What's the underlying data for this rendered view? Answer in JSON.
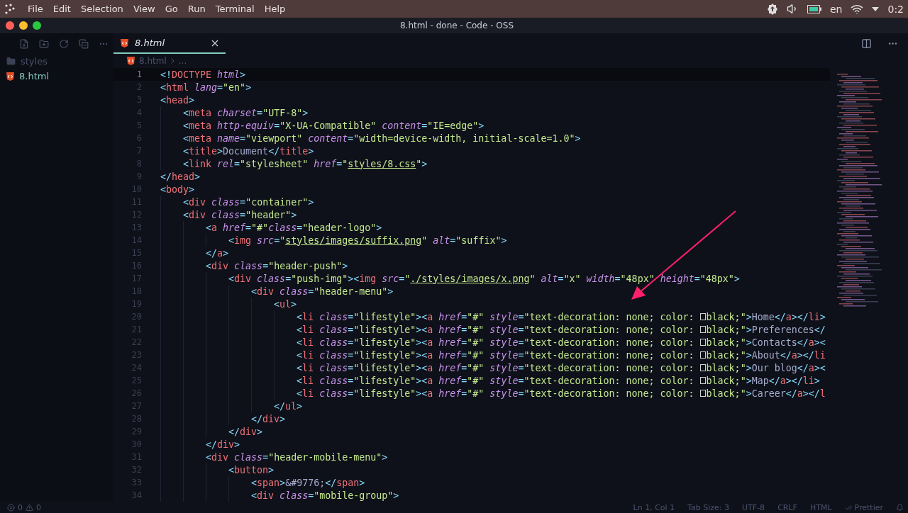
{
  "menu": [
    "File",
    "Edit",
    "Selection",
    "View",
    "Go",
    "Run",
    "Terminal",
    "Help"
  ],
  "tray": {
    "language": "en",
    "clock": "0:2"
  },
  "window": {
    "title": "8.html - done - Code - OSS"
  },
  "explorer": {
    "items": [
      {
        "kind": "folder",
        "label": "styles",
        "selected": false
      },
      {
        "kind": "file",
        "label": "8.html",
        "selected": true
      }
    ]
  },
  "tabs": [
    {
      "label": "8.html",
      "selected": true
    }
  ],
  "breadcrumb": [
    "8.html",
    "..."
  ],
  "lines": [
    {
      "n": "1",
      "current": true,
      "tokens": [
        {
          "kind": "punct",
          "t": "<!"
        },
        {
          "kind": "tag",
          "t": "DOCTYPE"
        },
        {
          "kind": "attr",
          "t": " html"
        },
        {
          "kind": "punct",
          "t": ">"
        }
      ]
    },
    {
      "n": "2",
      "current": false,
      "tokens": [
        {
          "kind": "punct",
          "t": "<"
        },
        {
          "kind": "tag",
          "t": "html"
        },
        {
          "kind": "attr",
          "t": " lang"
        },
        {
          "kind": "punct",
          "t": "="
        },
        {
          "kind": "string",
          "t": "\"en\""
        },
        {
          "kind": "punct",
          "t": ">"
        }
      ]
    },
    {
      "n": "3",
      "current": false,
      "tokens": [
        {
          "kind": "punct",
          "t": "<"
        },
        {
          "kind": "tag",
          "t": "head"
        },
        {
          "kind": "punct",
          "t": ">"
        }
      ]
    },
    {
      "n": "4",
      "current": false,
      "tokens": [
        {
          "kind": "punct",
          "t": "    <"
        },
        {
          "kind": "tag",
          "t": "meta"
        },
        {
          "kind": "attr",
          "t": " charset"
        },
        {
          "kind": "punct",
          "t": "="
        },
        {
          "kind": "string",
          "t": "\"UTF-8\""
        },
        {
          "kind": "punct",
          "t": ">"
        }
      ]
    },
    {
      "n": "5",
      "current": false,
      "tokens": [
        {
          "kind": "punct",
          "t": "    <"
        },
        {
          "kind": "tag",
          "t": "meta"
        },
        {
          "kind": "attr",
          "t": " http-equiv"
        },
        {
          "kind": "punct",
          "t": "="
        },
        {
          "kind": "string",
          "t": "\"X-UA-Compatible\""
        },
        {
          "kind": "attr",
          "t": " content"
        },
        {
          "kind": "punct",
          "t": "="
        },
        {
          "kind": "string",
          "t": "\"IE=edge\""
        },
        {
          "kind": "punct",
          "t": ">"
        }
      ]
    },
    {
      "n": "6",
      "current": false,
      "tokens": [
        {
          "kind": "punct",
          "t": "    <"
        },
        {
          "kind": "tag",
          "t": "meta"
        },
        {
          "kind": "attr",
          "t": " name"
        },
        {
          "kind": "punct",
          "t": "="
        },
        {
          "kind": "string",
          "t": "\"viewport\""
        },
        {
          "kind": "attr",
          "t": " content"
        },
        {
          "kind": "punct",
          "t": "="
        },
        {
          "kind": "string",
          "t": "\"width=device-width, initial-scale=1.0\""
        },
        {
          "kind": "punct",
          "t": ">"
        }
      ]
    },
    {
      "n": "7",
      "current": false,
      "tokens": [
        {
          "kind": "punct",
          "t": "    <"
        },
        {
          "kind": "tag",
          "t": "title"
        },
        {
          "kind": "punct",
          "t": ">"
        },
        {
          "kind": "text",
          "t": "Document"
        },
        {
          "kind": "punct",
          "t": "</"
        },
        {
          "kind": "tag",
          "t": "title"
        },
        {
          "kind": "punct",
          "t": ">"
        }
      ]
    },
    {
      "n": "8",
      "current": false,
      "tokens": [
        {
          "kind": "punct",
          "t": "    <"
        },
        {
          "kind": "tag",
          "t": "link"
        },
        {
          "kind": "attr",
          "t": " rel"
        },
        {
          "kind": "punct",
          "t": "="
        },
        {
          "kind": "string",
          "t": "\"stylesheet\""
        },
        {
          "kind": "attr",
          "t": " href"
        },
        {
          "kind": "punct",
          "t": "="
        },
        {
          "kind": "string",
          "t": "\""
        },
        {
          "kind": "link",
          "t": "styles/8.css"
        },
        {
          "kind": "string",
          "t": "\""
        },
        {
          "kind": "punct",
          "t": ">"
        }
      ]
    },
    {
      "n": "9",
      "current": false,
      "tokens": [
        {
          "kind": "punct",
          "t": "</"
        },
        {
          "kind": "tag",
          "t": "head"
        },
        {
          "kind": "punct",
          "t": ">"
        }
      ]
    },
    {
      "n": "10",
      "current": false,
      "tokens": [
        {
          "kind": "punct",
          "t": "<"
        },
        {
          "kind": "tag",
          "t": "body"
        },
        {
          "kind": "punct",
          "t": ">"
        }
      ]
    },
    {
      "n": "11",
      "current": false,
      "tokens": [
        {
          "kind": "punct",
          "t": "    <"
        },
        {
          "kind": "tag",
          "t": "div"
        },
        {
          "kind": "attr",
          "t": " class"
        },
        {
          "kind": "punct",
          "t": "="
        },
        {
          "kind": "string",
          "t": "\"container\""
        },
        {
          "kind": "punct",
          "t": ">"
        }
      ]
    },
    {
      "n": "12",
      "current": false,
      "tokens": [
        {
          "kind": "punct",
          "t": "    <"
        },
        {
          "kind": "tag",
          "t": "div"
        },
        {
          "kind": "attr",
          "t": " class"
        },
        {
          "kind": "punct",
          "t": "="
        },
        {
          "kind": "string",
          "t": "\"header\""
        },
        {
          "kind": "punct",
          "t": ">"
        }
      ]
    },
    {
      "n": "13",
      "current": false,
      "tokens": [
        {
          "kind": "punct",
          "t": "        <"
        },
        {
          "kind": "tag",
          "t": "a"
        },
        {
          "kind": "attr",
          "t": " href"
        },
        {
          "kind": "punct",
          "t": "="
        },
        {
          "kind": "string",
          "t": "\"#\""
        },
        {
          "kind": "attr",
          "t": "class"
        },
        {
          "kind": "punct",
          "t": "="
        },
        {
          "kind": "string",
          "t": "\"header-logo\""
        },
        {
          "kind": "punct",
          "t": ">"
        }
      ]
    },
    {
      "n": "14",
      "current": false,
      "tokens": [
        {
          "kind": "punct",
          "t": "            <"
        },
        {
          "kind": "tag",
          "t": "img"
        },
        {
          "kind": "attr",
          "t": " src"
        },
        {
          "kind": "punct",
          "t": "="
        },
        {
          "kind": "string",
          "t": "\""
        },
        {
          "kind": "link",
          "t": "styles/images/suffix.png"
        },
        {
          "kind": "string",
          "t": "\""
        },
        {
          "kind": "attr",
          "t": " alt"
        },
        {
          "kind": "punct",
          "t": "="
        },
        {
          "kind": "string",
          "t": "\"suffix\""
        },
        {
          "kind": "punct",
          "t": ">"
        }
      ]
    },
    {
      "n": "15",
      "current": false,
      "tokens": [
        {
          "kind": "punct",
          "t": "        </"
        },
        {
          "kind": "tag",
          "t": "a"
        },
        {
          "kind": "punct",
          "t": ">"
        }
      ]
    },
    {
      "n": "16",
      "current": false,
      "tokens": [
        {
          "kind": "punct",
          "t": "        <"
        },
        {
          "kind": "tag",
          "t": "div"
        },
        {
          "kind": "attr",
          "t": " class"
        },
        {
          "kind": "punct",
          "t": "="
        },
        {
          "kind": "string",
          "t": "\"header-push\""
        },
        {
          "kind": "punct",
          "t": ">"
        }
      ]
    },
    {
      "n": "17",
      "current": false,
      "tokens": [
        {
          "kind": "punct",
          "t": "            <"
        },
        {
          "kind": "tag",
          "t": "div"
        },
        {
          "kind": "attr",
          "t": " class"
        },
        {
          "kind": "punct",
          "t": "="
        },
        {
          "kind": "string",
          "t": "\"push-img\""
        },
        {
          "kind": "punct",
          "t": "><"
        },
        {
          "kind": "tag",
          "t": "img"
        },
        {
          "kind": "attr",
          "t": " src"
        },
        {
          "kind": "punct",
          "t": "="
        },
        {
          "kind": "string",
          "t": "\""
        },
        {
          "kind": "link",
          "t": "./styles/images/x.png"
        },
        {
          "kind": "string",
          "t": "\""
        },
        {
          "kind": "attr",
          "t": " alt"
        },
        {
          "kind": "punct",
          "t": "="
        },
        {
          "kind": "string",
          "t": "\"x\""
        },
        {
          "kind": "attr",
          "t": " width"
        },
        {
          "kind": "punct",
          "t": "="
        },
        {
          "kind": "string",
          "t": "\"48px\""
        },
        {
          "kind": "attr",
          "t": " height"
        },
        {
          "kind": "punct",
          "t": "="
        },
        {
          "kind": "string",
          "t": "\"48px\""
        },
        {
          "kind": "punct",
          "t": ">"
        }
      ]
    },
    {
      "n": "18",
      "current": false,
      "tokens": [
        {
          "kind": "punct",
          "t": "                <"
        },
        {
          "kind": "tag",
          "t": "div"
        },
        {
          "kind": "attr",
          "t": " class"
        },
        {
          "kind": "punct",
          "t": "="
        },
        {
          "kind": "string",
          "t": "\"header-menu\""
        },
        {
          "kind": "punct",
          "t": ">"
        }
      ]
    },
    {
      "n": "19",
      "current": false,
      "tokens": [
        {
          "kind": "punct",
          "t": "                    <"
        },
        {
          "kind": "tag",
          "t": "ul"
        },
        {
          "kind": "punct",
          "t": ">"
        }
      ]
    },
    {
      "n": "20",
      "current": false,
      "tokens": [
        {
          "kind": "punct",
          "t": "                        <"
        },
        {
          "kind": "tag",
          "t": "li"
        },
        {
          "kind": "attr",
          "t": " class"
        },
        {
          "kind": "punct",
          "t": "="
        },
        {
          "kind": "string",
          "t": "\"lifestyle\""
        },
        {
          "kind": "punct",
          "t": "><"
        },
        {
          "kind": "tag",
          "t": "a"
        },
        {
          "kind": "attr",
          "t": " href"
        },
        {
          "kind": "punct",
          "t": "="
        },
        {
          "kind": "string",
          "t": "\"#\""
        },
        {
          "kind": "attr",
          "t": " style"
        },
        {
          "kind": "punct",
          "t": "="
        },
        {
          "kind": "string",
          "t": "\"text-decoration: none; color: "
        },
        {
          "kind": "swatch"
        },
        {
          "kind": "string",
          "t": "black;\""
        },
        {
          "kind": "punct",
          "t": ">"
        },
        {
          "kind": "text",
          "t": "Home"
        },
        {
          "kind": "punct",
          "t": "</"
        },
        {
          "kind": "tag",
          "t": "a"
        },
        {
          "kind": "punct",
          "t": "></"
        },
        {
          "kind": "tag",
          "t": "li"
        },
        {
          "kind": "punct",
          "t": ">"
        }
      ]
    },
    {
      "n": "21",
      "current": false,
      "tokens": [
        {
          "kind": "punct",
          "t": "                        <"
        },
        {
          "kind": "tag",
          "t": "li"
        },
        {
          "kind": "attr",
          "t": " class"
        },
        {
          "kind": "punct",
          "t": "="
        },
        {
          "kind": "string",
          "t": "\"lifestyle\""
        },
        {
          "kind": "punct",
          "t": "><"
        },
        {
          "kind": "tag",
          "t": "a"
        },
        {
          "kind": "attr",
          "t": " href"
        },
        {
          "kind": "punct",
          "t": "="
        },
        {
          "kind": "string",
          "t": "\"#\""
        },
        {
          "kind": "attr",
          "t": " style"
        },
        {
          "kind": "punct",
          "t": "="
        },
        {
          "kind": "string",
          "t": "\"text-decoration: none; color: "
        },
        {
          "kind": "swatch"
        },
        {
          "kind": "string",
          "t": "black;\""
        },
        {
          "kind": "punct",
          "t": ">"
        },
        {
          "kind": "text",
          "t": "Preferences"
        },
        {
          "kind": "punct",
          "t": "</"
        }
      ]
    },
    {
      "n": "22",
      "current": false,
      "tokens": [
        {
          "kind": "punct",
          "t": "                        <"
        },
        {
          "kind": "tag",
          "t": "li"
        },
        {
          "kind": "attr",
          "t": " class"
        },
        {
          "kind": "punct",
          "t": "="
        },
        {
          "kind": "string",
          "t": "\"lifestyle\""
        },
        {
          "kind": "punct",
          "t": "><"
        },
        {
          "kind": "tag",
          "t": "a"
        },
        {
          "kind": "attr",
          "t": " href"
        },
        {
          "kind": "punct",
          "t": "="
        },
        {
          "kind": "string",
          "t": "\"#\""
        },
        {
          "kind": "attr",
          "t": " style"
        },
        {
          "kind": "punct",
          "t": "="
        },
        {
          "kind": "string",
          "t": "\"text-decoration: none; color: "
        },
        {
          "kind": "swatch"
        },
        {
          "kind": "string",
          "t": "black;\""
        },
        {
          "kind": "punct",
          "t": ">"
        },
        {
          "kind": "text",
          "t": "Contacts"
        },
        {
          "kind": "punct",
          "t": "</"
        },
        {
          "kind": "tag",
          "t": "a"
        },
        {
          "kind": "punct",
          "t": "><"
        }
      ]
    },
    {
      "n": "23",
      "current": false,
      "tokens": [
        {
          "kind": "punct",
          "t": "                        <"
        },
        {
          "kind": "tag",
          "t": "li"
        },
        {
          "kind": "attr",
          "t": " class"
        },
        {
          "kind": "punct",
          "t": "="
        },
        {
          "kind": "string",
          "t": "\"lifestyle\""
        },
        {
          "kind": "punct",
          "t": "><"
        },
        {
          "kind": "tag",
          "t": "a"
        },
        {
          "kind": "attr",
          "t": " href"
        },
        {
          "kind": "punct",
          "t": "="
        },
        {
          "kind": "string",
          "t": "\"#\""
        },
        {
          "kind": "attr",
          "t": " style"
        },
        {
          "kind": "punct",
          "t": "="
        },
        {
          "kind": "string",
          "t": "\"text-decoration: none; color: "
        },
        {
          "kind": "swatch"
        },
        {
          "kind": "string",
          "t": "black;\""
        },
        {
          "kind": "punct",
          "t": ">"
        },
        {
          "kind": "text",
          "t": "About"
        },
        {
          "kind": "punct",
          "t": "</"
        },
        {
          "kind": "tag",
          "t": "a"
        },
        {
          "kind": "punct",
          "t": "></"
        },
        {
          "kind": "tag",
          "t": "li"
        }
      ]
    },
    {
      "n": "24",
      "current": false,
      "tokens": [
        {
          "kind": "punct",
          "t": "                        <"
        },
        {
          "kind": "tag",
          "t": "li"
        },
        {
          "kind": "attr",
          "t": " class"
        },
        {
          "kind": "punct",
          "t": "="
        },
        {
          "kind": "string",
          "t": "\"lifestyle\""
        },
        {
          "kind": "punct",
          "t": "><"
        },
        {
          "kind": "tag",
          "t": "a"
        },
        {
          "kind": "attr",
          "t": " href"
        },
        {
          "kind": "punct",
          "t": "="
        },
        {
          "kind": "string",
          "t": "\"#\""
        },
        {
          "kind": "attr",
          "t": " style"
        },
        {
          "kind": "punct",
          "t": "="
        },
        {
          "kind": "string",
          "t": "\"text-decoration: none; color: "
        },
        {
          "kind": "swatch"
        },
        {
          "kind": "string",
          "t": "black;\""
        },
        {
          "kind": "punct",
          "t": ">"
        },
        {
          "kind": "text",
          "t": "Our blog"
        },
        {
          "kind": "punct",
          "t": "</"
        },
        {
          "kind": "tag",
          "t": "a"
        },
        {
          "kind": "punct",
          "t": "><"
        }
      ]
    },
    {
      "n": "25",
      "current": false,
      "tokens": [
        {
          "kind": "punct",
          "t": "                        <"
        },
        {
          "kind": "tag",
          "t": "li"
        },
        {
          "kind": "attr",
          "t": " class"
        },
        {
          "kind": "punct",
          "t": "="
        },
        {
          "kind": "string",
          "t": "\"lifestyle\""
        },
        {
          "kind": "punct",
          "t": "><"
        },
        {
          "kind": "tag",
          "t": "a"
        },
        {
          "kind": "attr",
          "t": " href"
        },
        {
          "kind": "punct",
          "t": "="
        },
        {
          "kind": "string",
          "t": "\"#\""
        },
        {
          "kind": "attr",
          "t": " style"
        },
        {
          "kind": "punct",
          "t": "="
        },
        {
          "kind": "string",
          "t": "\"text-decoration: none; color: "
        },
        {
          "kind": "swatch"
        },
        {
          "kind": "string",
          "t": "black;\""
        },
        {
          "kind": "punct",
          "t": ">"
        },
        {
          "kind": "text",
          "t": "Map"
        },
        {
          "kind": "punct",
          "t": "</"
        },
        {
          "kind": "tag",
          "t": "a"
        },
        {
          "kind": "punct",
          "t": "></"
        },
        {
          "kind": "tag",
          "t": "li"
        },
        {
          "kind": "punct",
          "t": ">"
        }
      ]
    },
    {
      "n": "26",
      "current": false,
      "tokens": [
        {
          "kind": "punct",
          "t": "                        <"
        },
        {
          "kind": "tag",
          "t": "li"
        },
        {
          "kind": "attr",
          "t": " class"
        },
        {
          "kind": "punct",
          "t": "="
        },
        {
          "kind": "string",
          "t": "\"lifestyle\""
        },
        {
          "kind": "punct",
          "t": "><"
        },
        {
          "kind": "tag",
          "t": "a"
        },
        {
          "kind": "attr",
          "t": " href"
        },
        {
          "kind": "punct",
          "t": "="
        },
        {
          "kind": "string",
          "t": "\"#\""
        },
        {
          "kind": "attr",
          "t": " style"
        },
        {
          "kind": "punct",
          "t": "="
        },
        {
          "kind": "string",
          "t": "\"text-decoration: none; color: "
        },
        {
          "kind": "swatch"
        },
        {
          "kind": "string",
          "t": "black;\""
        },
        {
          "kind": "punct",
          "t": ">"
        },
        {
          "kind": "text",
          "t": "Career"
        },
        {
          "kind": "punct",
          "t": "</"
        },
        {
          "kind": "tag",
          "t": "a"
        },
        {
          "kind": "punct",
          "t": "></"
        },
        {
          "kind": "tag",
          "t": "l"
        }
      ]
    },
    {
      "n": "27",
      "current": false,
      "tokens": [
        {
          "kind": "punct",
          "t": "                    </"
        },
        {
          "kind": "tag",
          "t": "ul"
        },
        {
          "kind": "punct",
          "t": ">"
        }
      ]
    },
    {
      "n": "28",
      "current": false,
      "tokens": [
        {
          "kind": "punct",
          "t": "                </"
        },
        {
          "kind": "tag",
          "t": "div"
        },
        {
          "kind": "punct",
          "t": ">"
        }
      ]
    },
    {
      "n": "29",
      "current": false,
      "tokens": [
        {
          "kind": "punct",
          "t": "            </"
        },
        {
          "kind": "tag",
          "t": "div"
        },
        {
          "kind": "punct",
          "t": ">"
        }
      ]
    },
    {
      "n": "30",
      "current": false,
      "tokens": [
        {
          "kind": "punct",
          "t": "        </"
        },
        {
          "kind": "tag",
          "t": "div"
        },
        {
          "kind": "punct",
          "t": ">"
        }
      ]
    },
    {
      "n": "31",
      "current": false,
      "tokens": [
        {
          "kind": "punct",
          "t": "        <"
        },
        {
          "kind": "tag",
          "t": "div"
        },
        {
          "kind": "attr",
          "t": " class"
        },
        {
          "kind": "punct",
          "t": "="
        },
        {
          "kind": "string",
          "t": "\"header-mobile-menu\""
        },
        {
          "kind": "punct",
          "t": ">"
        }
      ]
    },
    {
      "n": "32",
      "current": false,
      "tokens": [
        {
          "kind": "punct",
          "t": "            <"
        },
        {
          "kind": "tag",
          "t": "button"
        },
        {
          "kind": "punct",
          "t": ">"
        }
      ]
    },
    {
      "n": "33",
      "current": false,
      "tokens": [
        {
          "kind": "punct",
          "t": "                <"
        },
        {
          "kind": "tag",
          "t": "span"
        },
        {
          "kind": "punct",
          "t": ">"
        },
        {
          "kind": "text",
          "t": "&#9776;"
        },
        {
          "kind": "punct",
          "t": "</"
        },
        {
          "kind": "tag",
          "t": "span"
        },
        {
          "kind": "punct",
          "t": ">"
        }
      ]
    },
    {
      "n": "34",
      "current": false,
      "tokens": [
        {
          "kind": "punct",
          "t": "                <"
        },
        {
          "kind": "tag",
          "t": "div"
        },
        {
          "kind": "attr",
          "t": " class"
        },
        {
          "kind": "punct",
          "t": "="
        },
        {
          "kind": "string",
          "t": "\"mobile-group\""
        },
        {
          "kind": "punct",
          "t": ">"
        }
      ]
    }
  ],
  "status": {
    "errors": "0",
    "warnings": "0",
    "items": [
      {
        "kind": "text",
        "label": "Ln 1, Col 1"
      },
      {
        "kind": "text",
        "label": "Tab Size: 3"
      },
      {
        "kind": "text",
        "label": "UTF-8"
      },
      {
        "kind": "text",
        "label": "CRLF"
      },
      {
        "kind": "text",
        "label": "HTML"
      },
      {
        "kind": "prettier",
        "label": "Prettier"
      }
    ]
  }
}
